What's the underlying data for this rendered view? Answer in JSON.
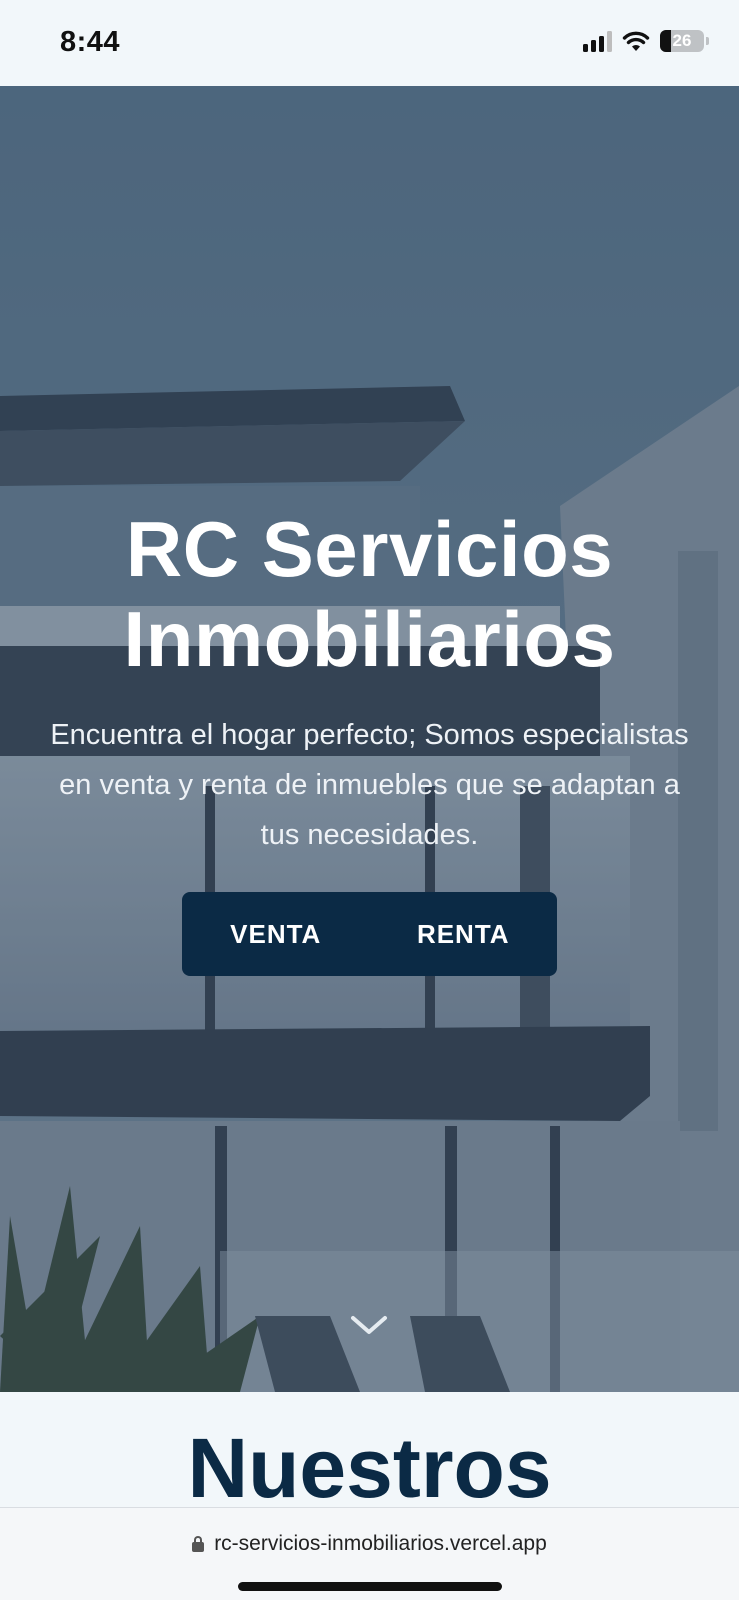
{
  "status_bar": {
    "time": "8:44",
    "battery_level": "26",
    "icons": [
      "signal-icon",
      "wifi-icon",
      "battery-icon"
    ]
  },
  "hero": {
    "title_line1": "RC Servicios",
    "title_line2": "Inmobiliarios",
    "subtitle": "Encuentra el hogar perfecto; Somos especialistas en venta y renta de inmuebles que se adaptan a tus necesidades.",
    "buttons": {
      "sale_label": "VENTA",
      "rent_label": "RENTA"
    },
    "scroll_icon": "chevron-down-icon",
    "button_bg_color": "#0b2a45"
  },
  "next_section": {
    "heading": "Nuestros"
  },
  "browser": {
    "url": "rc-servicios-inmobiliarios.vercel.app",
    "icons": [
      "lock-icon"
    ]
  }
}
